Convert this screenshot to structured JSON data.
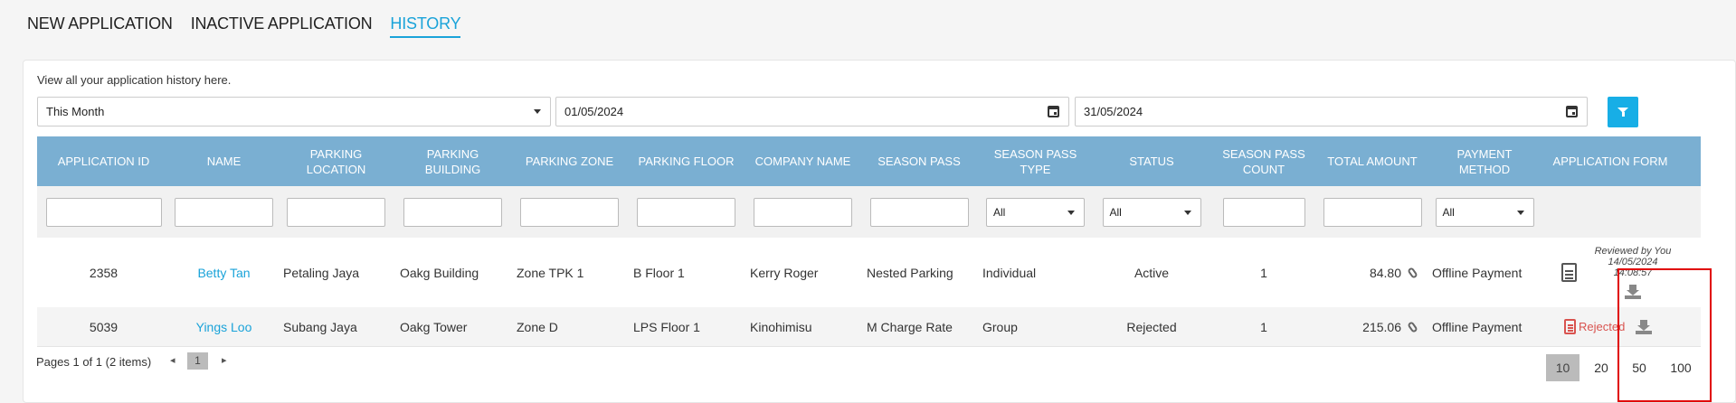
{
  "tabs": [
    {
      "label": "NEW APPLICATION",
      "active": false
    },
    {
      "label": "INACTIVE APPLICATION",
      "active": false
    },
    {
      "label": "HISTORY",
      "active": true
    }
  ],
  "hint": "View all your application history here.",
  "filters": {
    "period": "This Month",
    "date_from": "01/05/2024",
    "date_to": "31/05/2024"
  },
  "columns": [
    "APPLICATION ID",
    "NAME",
    "PARKING LOCATION",
    "PARKING BUILDING",
    "PARKING ZONE",
    "PARKING FLOOR",
    "COMPANY NAME",
    "SEASON PASS",
    "SEASON PASS TYPE",
    "STATUS",
    "SEASON PASS COUNT",
    "TOTAL AMOUNT",
    "PAYMENT METHOD",
    "APPLICATION FORM"
  ],
  "filter_row": {
    "season_pass_type": "All",
    "status": "All",
    "payment_method": "All"
  },
  "rows": [
    {
      "id": "2358",
      "name": "Betty Tan",
      "location": "Petaling Jaya",
      "building": "Oakg Building",
      "zone": "Zone TPK 1",
      "floor": "B Floor 1",
      "company": "Kerry Roger",
      "season_pass": "Nested Parking",
      "type": "Individual",
      "status": "Active",
      "count": "1",
      "amount": "84.80",
      "payment": "Offline Payment",
      "reviewed_line1": "Reviewed by You",
      "reviewed_date": "14/05/2024",
      "reviewed_time": "14:08:57"
    },
    {
      "id": "5039",
      "name": "Yings Loo",
      "location": "Subang Jaya",
      "building": "Oakg Tower",
      "zone": "Zone D",
      "floor": "LPS Floor 1",
      "company": "Kinohimisu",
      "season_pass": "M Charge Rate",
      "type": "Group",
      "status": "Rejected",
      "count": "1",
      "amount": "215.06",
      "payment": "Offline Payment",
      "form_status": "Rejected"
    }
  ],
  "pager": {
    "info": "Pages 1 of 1 (2 items)",
    "current_page": "1",
    "prev": "◂",
    "next": "▸",
    "sizes": [
      "10",
      "20",
      "50",
      "100"
    ]
  },
  "colors": {
    "accent": "#1aa3d9",
    "header": "#7aafd2",
    "rejected": "#d9534f",
    "highlight": "#e00000"
  }
}
